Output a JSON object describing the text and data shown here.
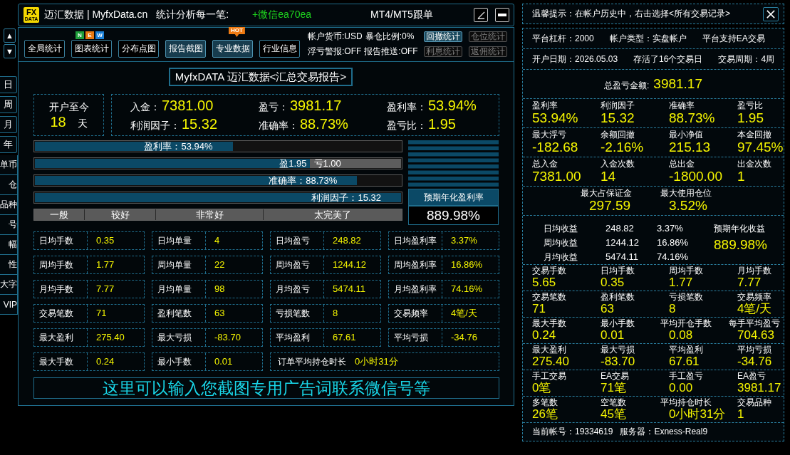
{
  "scroll_arrows": [
    "▲",
    "▼"
  ],
  "period_tabs": [
    "日",
    "周",
    "月",
    "年"
  ],
  "side_tabs": [
    "单币",
    "仓",
    "品种",
    "号",
    "幅",
    "性",
    "大字",
    "VIP"
  ],
  "title_bar": {
    "logo": {
      "top": "FX",
      "bottom": "DATA"
    },
    "title": "迈汇数据 | MyfxData.cn",
    "slogan": "统计分析每一笔:",
    "contact": "+微信ea70ea",
    "copy_trading": "MT4/MT5跟单",
    "window_buttons": [
      {
        "kind": "angle"
      },
      {
        "kind": "minimize"
      }
    ]
  },
  "toolbar": {
    "buttons": [
      {
        "label": "全局统计",
        "highlighted": false
      },
      {
        "label": "图表统计",
        "highlighted": false,
        "badge": {
          "kind": "letters",
          "letters": [
            {
              "text": "N",
              "color": "#1e9e3a"
            },
            {
              "text": "E",
              "color": "#e8780e"
            },
            {
              "text": "W",
              "color": "#1a7fd6"
            }
          ]
        }
      },
      {
        "label": "分布点图",
        "highlighted": false
      },
      {
        "label": "报告截图",
        "highlighted": true
      },
      {
        "label": "专业数据",
        "highlighted": true,
        "badge": {
          "kind": "bubble",
          "text": "HOT"
        }
      },
      {
        "label": "行业信息",
        "highlighted": false
      }
    ],
    "status_rows": [
      [
        "帐户货币:USD",
        "暴仓比例:0%"
      ],
      [
        "浮亏警报:OFF",
        "报告推送:OFF"
      ]
    ],
    "stat_buttons": [
      {
        "label": "回撤统计",
        "disabled": false
      },
      {
        "label": "仓位统计",
        "disabled": true
      },
      {
        "label": "利息统计",
        "disabled": true
      },
      {
        "label": "返佣统计",
        "disabled": true
      }
    ]
  },
  "report": {
    "title": "MyfxDATA 迈汇数据<汇总交易报告>",
    "since_open": {
      "label": "开户至今",
      "value": "18",
      "unit": "天"
    },
    "summary": [
      {
        "label": "入金：",
        "value": "7381.00"
      },
      {
        "label": "盈亏：",
        "value": "3981.17"
      },
      {
        "label": "盈利率：",
        "value": "53.94%"
      },
      {
        "label": "利润因子：",
        "value": "15.32"
      },
      {
        "label": "准确率：",
        "value": "88.73%"
      },
      {
        "label": "盈亏比：",
        "value": "1.95"
      }
    ],
    "bars": [
      {
        "kind": "single",
        "label": "盈利率：53.94%",
        "level": 0.54
      },
      {
        "kind": "split",
        "label": "盈1.95",
        "rest_label": "亏1.00",
        "level": 0.75
      },
      {
        "kind": "single",
        "label": "准确率：88.73%",
        "level": 0.88
      },
      {
        "kind": "single",
        "label": "利润因子：15.32",
        "level": 1.0
      }
    ],
    "rating_scale": [
      "一般",
      "较好",
      "非常好",
      "太完美了"
    ],
    "annual": {
      "label": "预期年化盈利率",
      "value": "889.98%"
    },
    "stats_rows": [
      [
        {
          "kind": "normal",
          "label": "日均手数",
          "value": "0.35"
        },
        {
          "kind": "normal",
          "label": "日均单量",
          "value": "4"
        },
        {
          "kind": "normal",
          "label": "日均盈亏",
          "value": "248.82"
        },
        {
          "kind": "normal",
          "label": "日均盈利率",
          "value": "3.37%"
        }
      ],
      [
        {
          "kind": "normal",
          "label": "周均手数",
          "value": "1.77"
        },
        {
          "kind": "normal",
          "label": "周均单量",
          "value": "22"
        },
        {
          "kind": "normal",
          "label": "周均盈亏",
          "value": "1244.12"
        },
        {
          "kind": "normal",
          "label": "周均盈利率",
          "value": "16.86%"
        }
      ],
      [
        {
          "kind": "normal",
          "label": "月均手数",
          "value": "7.77"
        },
        {
          "kind": "normal",
          "label": "月均单量",
          "value": "98"
        },
        {
          "kind": "normal",
          "label": "月均盈亏",
          "value": "5474.11"
        },
        {
          "kind": "normal",
          "label": "月均盈利率",
          "value": "74.16%"
        }
      ],
      [
        {
          "kind": "normal",
          "label": "交易笔数",
          "value": "71"
        },
        {
          "kind": "normal",
          "label": "盈利笔数",
          "value": "63"
        },
        {
          "kind": "normal",
          "label": "亏损笔数",
          "value": "8"
        },
        {
          "kind": "normal",
          "label": "交易频率",
          "value": "4笔/天"
        }
      ],
      [
        {
          "kind": "normal",
          "label": "最大盈利",
          "value": "275.40"
        },
        {
          "kind": "normal",
          "label": "最大亏损",
          "value": "-83.70"
        },
        {
          "kind": "normal",
          "label": "平均盈利",
          "value": "67.61"
        },
        {
          "kind": "normal",
          "label": "平均亏损",
          "value": "-34.76"
        }
      ],
      [
        {
          "kind": "normal",
          "label": "最大手数",
          "value": "0.24"
        },
        {
          "kind": "normal",
          "label": "最小手数",
          "value": "0.01"
        },
        {
          "kind": "wide",
          "label": "订单平均持仓时长",
          "value": "0小时31分"
        }
      ]
    ],
    "ad": "这里可以输入您截图专用广告词联系微信号等"
  },
  "details": {
    "tip": "温馨提示：在帐户历史中，右击选择<所有交易记录>",
    "sections": [
      {
        "kind": "info",
        "items": [
          "平台杠杆：2000",
          "帐户类型：实盘帐户",
          "平台支持EA交易"
        ]
      },
      {
        "kind": "info",
        "items": [
          "开户日期：2026.05.03",
          "存活了16个交易日",
          "交易周期：4周"
        ]
      },
      {
        "kind": "total",
        "label": "总盈亏金额:",
        "value": "3981.17"
      },
      {
        "kind": "metrics",
        "items": [
          {
            "label": "盈利率",
            "value": "53.94%"
          },
          {
            "label": "利润因子",
            "value": "15.32"
          },
          {
            "label": "准确率",
            "value": "88.73%"
          },
          {
            "label": "盈亏比",
            "value": "1.95"
          }
        ]
      },
      {
        "kind": "metrics",
        "items": [
          {
            "label": "最大浮亏",
            "value": "-182.68"
          },
          {
            "label": "余额回撤",
            "value": "-2.16%"
          },
          {
            "label": "最小净值",
            "value": "215.13"
          },
          {
            "label": "本金回撤",
            "value": "97.45%"
          }
        ]
      },
      {
        "kind": "metrics",
        "items": [
          {
            "label": "总入金",
            "value": "7381.00"
          },
          {
            "label": "入金次数",
            "value": "14"
          },
          {
            "label": "总出金",
            "value": "-1800.00"
          },
          {
            "label": "出金次数",
            "value": "1"
          }
        ]
      },
      {
        "kind": "centered_metrics",
        "items": [
          {
            "label": "最大占保证金",
            "value": "297.59"
          },
          {
            "label": "最大使用仓位",
            "value": "3.52%"
          }
        ]
      },
      {
        "kind": "income",
        "rows": [
          {
            "label": "日均收益",
            "amount": "248.82",
            "rate": "3.37%"
          },
          {
            "label": "周均收益",
            "amount": "1244.12",
            "rate": "16.86%"
          },
          {
            "label": "月均收益",
            "amount": "5474.11",
            "rate": "74.16%"
          }
        ],
        "annual_label": "预期年化收益",
        "annual_value": "889.98%"
      },
      {
        "kind": "compact_metrics",
        "items": [
          {
            "label": "交易手数",
            "value": "5.65"
          },
          {
            "label": "日均手数",
            "value": "0.35"
          },
          {
            "label": "周均手数",
            "value": "1.77"
          },
          {
            "label": "月均手数",
            "value": "7.77"
          }
        ]
      },
      {
        "kind": "compact_metrics",
        "items": [
          {
            "label": "交易笔数",
            "value": "71"
          },
          {
            "label": "盈利笔数",
            "value": "63"
          },
          {
            "label": "亏损笔数",
            "value": "8"
          },
          {
            "label": "交易频率",
            "value": "4笔/天"
          }
        ]
      },
      {
        "kind": "compact_metrics",
        "items": [
          {
            "label": "最大手数",
            "value": "0.24"
          },
          {
            "label": "最小手数",
            "value": "0.01"
          },
          {
            "label": "平均开仓手数",
            "value": "0.08"
          },
          {
            "label": "每手平均盈亏",
            "value": "704.63"
          }
        ]
      },
      {
        "kind": "compact_metrics",
        "items": [
          {
            "label": "最大盈利",
            "value": "275.40"
          },
          {
            "label": "最大亏损",
            "value": "-83.70"
          },
          {
            "label": "平均盈利",
            "value": "67.61"
          },
          {
            "label": "平均亏损",
            "value": "-34.76"
          }
        ]
      },
      {
        "kind": "compact_metrics",
        "items": [
          {
            "label": "手工交易",
            "value": "0笔"
          },
          {
            "label": "EA交易",
            "value": "71笔"
          },
          {
            "label": "手工盈亏",
            "value": "0.00"
          },
          {
            "label": "EA盈亏",
            "value": "3981.17"
          }
        ]
      },
      {
        "kind": "compact_metrics",
        "items": [
          {
            "label": "多笔数",
            "value": "26笔"
          },
          {
            "label": "空笔数",
            "value": "45笔"
          },
          {
            "label": "平均持仓时长",
            "value": "0小时31分"
          },
          {
            "label": "交易品种",
            "value": "1"
          }
        ]
      },
      {
        "kind": "footer",
        "items": [
          "当前帐号：19334619",
          "服务器：Exness-Real9"
        ]
      }
    ]
  }
}
